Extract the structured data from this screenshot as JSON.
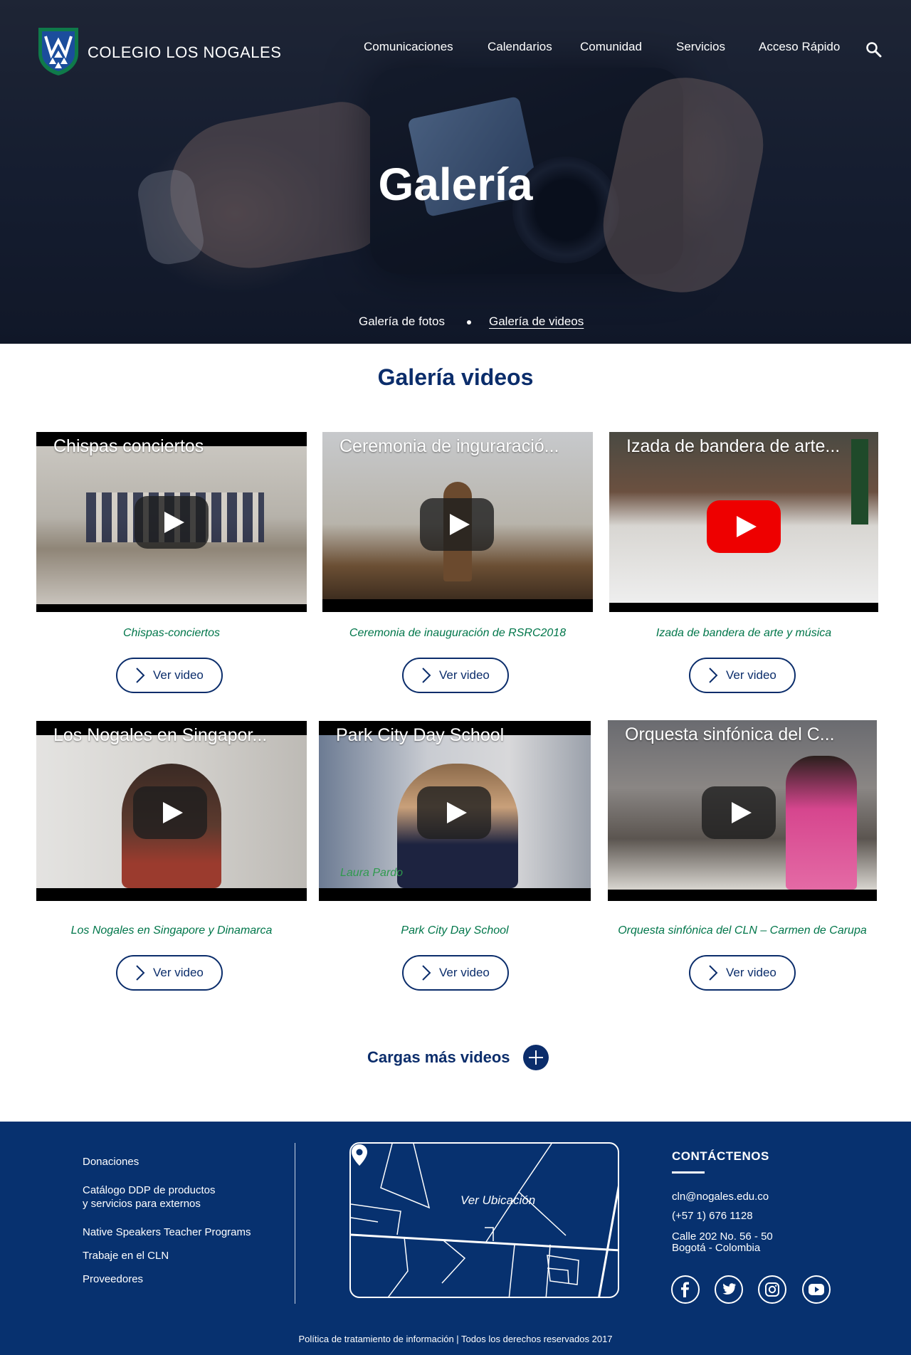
{
  "brand": {
    "name": "COLEGIO LOS NOGALES",
    "primary": "#0b2d6b",
    "accent_green": "#00764a",
    "footer_bg": "#07316f"
  },
  "nav": {
    "items": [
      "Comunicaciones",
      "Calendarios",
      "Comunidad",
      "Servicios",
      "Acceso Rápido"
    ],
    "search_icon": "search-icon"
  },
  "hero": {
    "title": "Galería",
    "subnav": [
      "Galería de fotos",
      "Galería de videos"
    ],
    "active_subnav": "Galería de videos"
  },
  "gallery": {
    "title": "Galería videos",
    "button_label": "Ver video",
    "videos": [
      {
        "thumb_title": "Chispas conciertos",
        "caption": "Chispas-conciertos",
        "player": "dark"
      },
      {
        "thumb_title": "Ceremonia de inguraració...",
        "caption": "Ceremonia de inauguración de RSRC2018",
        "player": "dark"
      },
      {
        "thumb_title": "Izada de bandera de arte...",
        "caption": "Izada de bandera de arte y música",
        "player": "youtube-red"
      },
      {
        "thumb_title": "Los Nogales en Singapor...",
        "caption": "Los Nogales en Singapore y Dinamarca",
        "player": "dark"
      },
      {
        "thumb_title": "Park City Day School",
        "caption": "Park City Day School",
        "player": "dark",
        "overlay_text": "Laura Pardo"
      },
      {
        "thumb_title": "Orquesta sinfónica del C...",
        "caption": "Orquesta sinfónica del CLN – Carmen de Carupa",
        "player": "dark"
      }
    ],
    "load_more": "Cargas más videos"
  },
  "footer": {
    "links": [
      "Donaciones",
      "Catálogo DDP de productos\ny servicios para externos",
      "Native Speakers Teacher Programs",
      "Trabaje en el CLN",
      "Proveedores"
    ],
    "map_label": "Ver Ubicación",
    "contact": {
      "title": "CONTÁCTENOS",
      "email": "cln@nogales.edu.co",
      "phone": "(+57 1) 676 1128",
      "address_1": "Calle 202 No. 56 - 50",
      "address_2": "Bogotá - Colombia"
    },
    "social": [
      "facebook-icon",
      "twitter-icon",
      "instagram-icon",
      "youtube-icon"
    ],
    "legal": "Política de tratamiento de información | Todos los derechos reservados 2017"
  }
}
